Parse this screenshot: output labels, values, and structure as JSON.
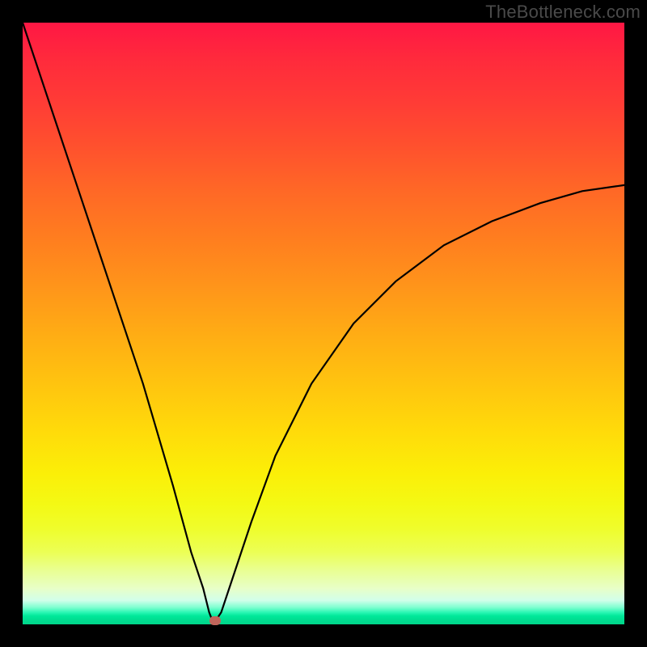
{
  "watermark": "TheBottleneck.com",
  "colors": {
    "frame_background": "#000000",
    "watermark_text": "#4a4a4a",
    "curve_stroke": "#000000",
    "marker_fill": "#c0655b",
    "gradient_top": "#ff1744",
    "gradient_bottom": "#00d589"
  },
  "chart_data": {
    "type": "line",
    "title": "",
    "xlabel": "",
    "ylabel": "",
    "xlim": [
      0,
      100
    ],
    "ylim": [
      0,
      100
    ],
    "grid": false,
    "legend": false,
    "series": [
      {
        "name": "bottleneck-curve",
        "x": [
          0,
          5,
          10,
          15,
          20,
          25,
          28,
          30,
          31,
          31.5,
          32,
          33,
          35,
          38,
          42,
          48,
          55,
          62,
          70,
          78,
          86,
          93,
          100
        ],
        "values": [
          100,
          85,
          70,
          55,
          40,
          23,
          12,
          6,
          2,
          0.7,
          0.5,
          2,
          8,
          17,
          28,
          40,
          50,
          57,
          63,
          67,
          70,
          72,
          73
        ]
      }
    ],
    "marker": {
      "x": 32,
      "y": 0.5
    }
  }
}
